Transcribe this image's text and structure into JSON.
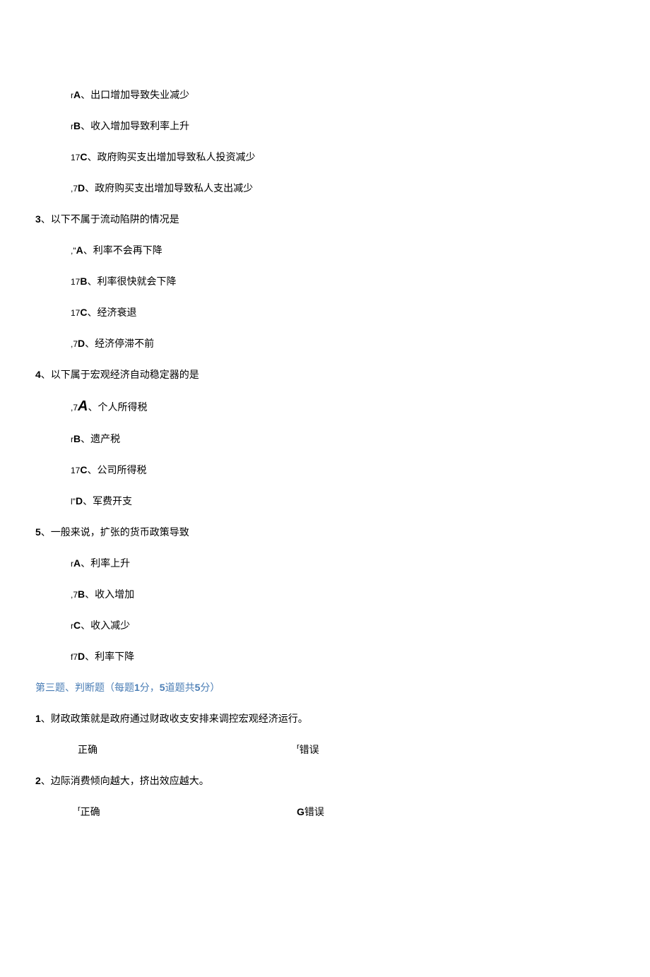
{
  "q2_options": [
    {
      "marker": "r",
      "label": "A",
      "sep": "、",
      "text": "出口增加导致失业减少"
    },
    {
      "marker": "r",
      "label": "B",
      "sep": "、",
      "text": "收入增加导致利率上升"
    },
    {
      "marker": "17",
      "label": "C",
      "sep": "、",
      "text": "政府购买支出增加导致私人投资减少"
    },
    {
      "marker": ",7",
      "label": "D",
      "sep": "、",
      "text": "政府购买支出增加导致私人支出减少"
    }
  ],
  "q3": {
    "num": "3",
    "sep": "、",
    "text": "以下不属于流动陷阱的情况是"
  },
  "q3_options": [
    {
      "marker": ",\"",
      "label": "A",
      "sep": "、",
      "text": "利率不会再下降"
    },
    {
      "marker": "17",
      "label": "B",
      "sep": "、",
      "text": "利率很快就会下降"
    },
    {
      "marker": "17",
      "label": "C",
      "sep": "、",
      "text": "经济衰退"
    },
    {
      "marker": ",7",
      "label": "D",
      "sep": "、",
      "text": "经济停滞不前"
    }
  ],
  "q4": {
    "num": "4",
    "sep": "、",
    "text": "以下属于宏观经济自动稳定器的是"
  },
  "q4_options": [
    {
      "marker": ",7",
      "label_italic": "A",
      "sep": "、",
      "text": "个人所得税"
    },
    {
      "marker": "r",
      "label": "B",
      "sep": "、",
      "text": "遗产税"
    },
    {
      "marker": "17",
      "label": "C",
      "sep": "、",
      "text": "公司所得税"
    },
    {
      "marker": "l\"",
      "label": "D",
      "sep": "、",
      "text": "军费开支"
    }
  ],
  "q5": {
    "num": "5",
    "sep": "、",
    "text": "一般来说，扩张的货币政策导致"
  },
  "q5_options": [
    {
      "marker": "r",
      "label": "A",
      "sep": "、",
      "text": "利率上升"
    },
    {
      "marker": ",7",
      "label": "B",
      "sep": "、",
      "text": "收入增加"
    },
    {
      "marker": "r",
      "label": "C",
      "sep": "、",
      "text": "收入减少"
    },
    {
      "marker": "f7",
      "label": "D",
      "sep": "、",
      "text": "利率下降"
    }
  ],
  "section3": {
    "p1": "第三题、判断题（每题",
    "b1": "1",
    "p2": "分，",
    "b2": "5",
    "p3": "道题共",
    "b3": "5",
    "p4": "分）"
  },
  "tf1": {
    "num": "1",
    "sep": "、",
    "text": "财政政策就是政府通过财政收支安排来调控宏观经济运行。"
  },
  "tf1_choices": {
    "left_marker": "",
    "left": "正确",
    "right_marker": "r",
    "right": "错误"
  },
  "tf2": {
    "num": "2",
    "sep": "、",
    "text": "边际消费倾向越大，挤出效应越大。"
  },
  "tf2_choices": {
    "left_marker": "r",
    "left": "正确",
    "right_marker": "G",
    "right": "错误"
  }
}
